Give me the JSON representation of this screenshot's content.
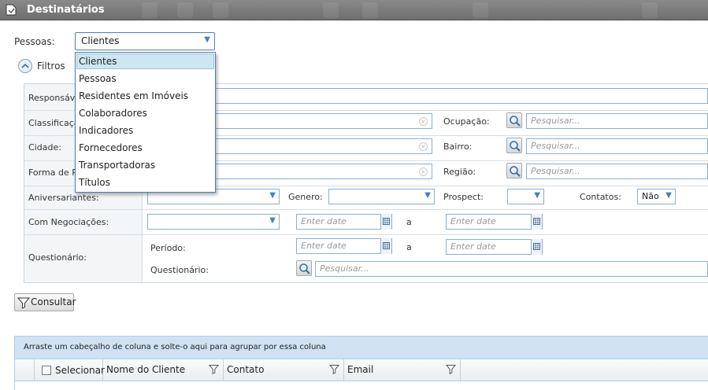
{
  "window": {
    "title": "Destinatários"
  },
  "pessoas": {
    "label": "Pessoas:",
    "value": "Clientes",
    "options": [
      "Clientes",
      "Pessoas",
      "Residentes em Imóveis",
      "Colaboradores",
      "Indicadores",
      "Fornecedores",
      "Transportadoras",
      "Títulos"
    ]
  },
  "filtros": {
    "label": "Filtros"
  },
  "fields": {
    "responsavel": "Responsáve",
    "classificacao": "Classificaçã",
    "cidade": "Cidade:",
    "forma": "Forma de Pa",
    "aniversariantes": "Aniversariantes:",
    "com_negociacoes": "Com Negociações:",
    "questionario_label": "Questionário:"
  },
  "search_placeholder": "Pesquisar...",
  "ocupacao": {
    "label": "Ocupação:"
  },
  "bairro": {
    "label": "Bairro:"
  },
  "regiao": {
    "label": "Região:"
  },
  "genero": {
    "label": "Genero:"
  },
  "prospect": {
    "label": "Prospect:"
  },
  "contatos": {
    "label": "Contatos:",
    "value": "Não"
  },
  "date_placeholder": "Enter date",
  "date_sep": "a",
  "periodo": {
    "label": "Período:"
  },
  "questionario_sub": {
    "label": "Questionário:"
  },
  "consultar_label": "Consultar",
  "grid": {
    "group_hint": "Arraste um cabeçalho de coluna e solte-o aqui para agrupar por essa coluna",
    "columns": [
      "Selecionar",
      "Nome do Cliente",
      "Contato",
      "Email"
    ]
  },
  "colors": {
    "accent": "#4c80b6",
    "groupbar": "#cfe2f3",
    "selected": "#cde6f0"
  }
}
